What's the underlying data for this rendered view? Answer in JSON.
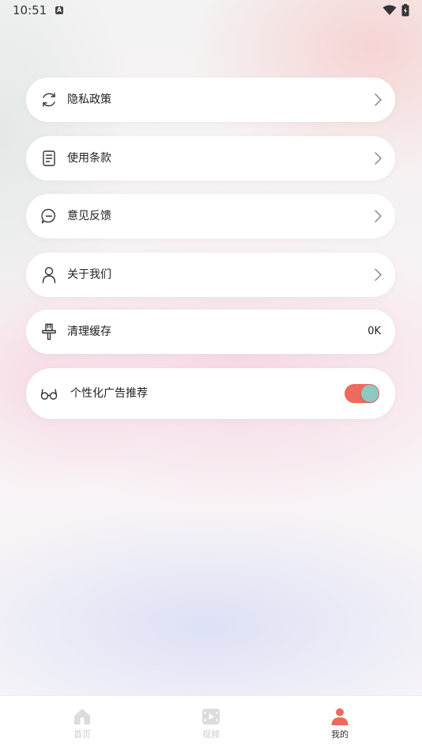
{
  "status_bar": {
    "time": "10:51",
    "notification_icon": "A"
  },
  "menu": {
    "items": [
      {
        "label": "隐私政策",
        "icon": "refresh-circle-icon"
      },
      {
        "label": "使用条款",
        "icon": "document-icon"
      },
      {
        "label": "意见反馈",
        "icon": "chat-bubble-icon"
      },
      {
        "label": "关于我们",
        "icon": "person-icon"
      },
      {
        "label": "清理缓存",
        "icon": "brush-icon",
        "value": "0K"
      },
      {
        "label": "个性化广告推荐",
        "icon": "glasses-icon",
        "toggle_on": true
      }
    ]
  },
  "bottom_nav": {
    "items": [
      {
        "label": "首页",
        "icon": "home-icon",
        "active": false
      },
      {
        "label": "视频",
        "icon": "video-icon",
        "active": false
      },
      {
        "label": "我的",
        "icon": "profile-icon",
        "active": true
      }
    ]
  },
  "colors": {
    "accent": "#ee6a5e",
    "toggle_knob": "#8ccac2",
    "inactive_nav": "#d8d8d8"
  }
}
